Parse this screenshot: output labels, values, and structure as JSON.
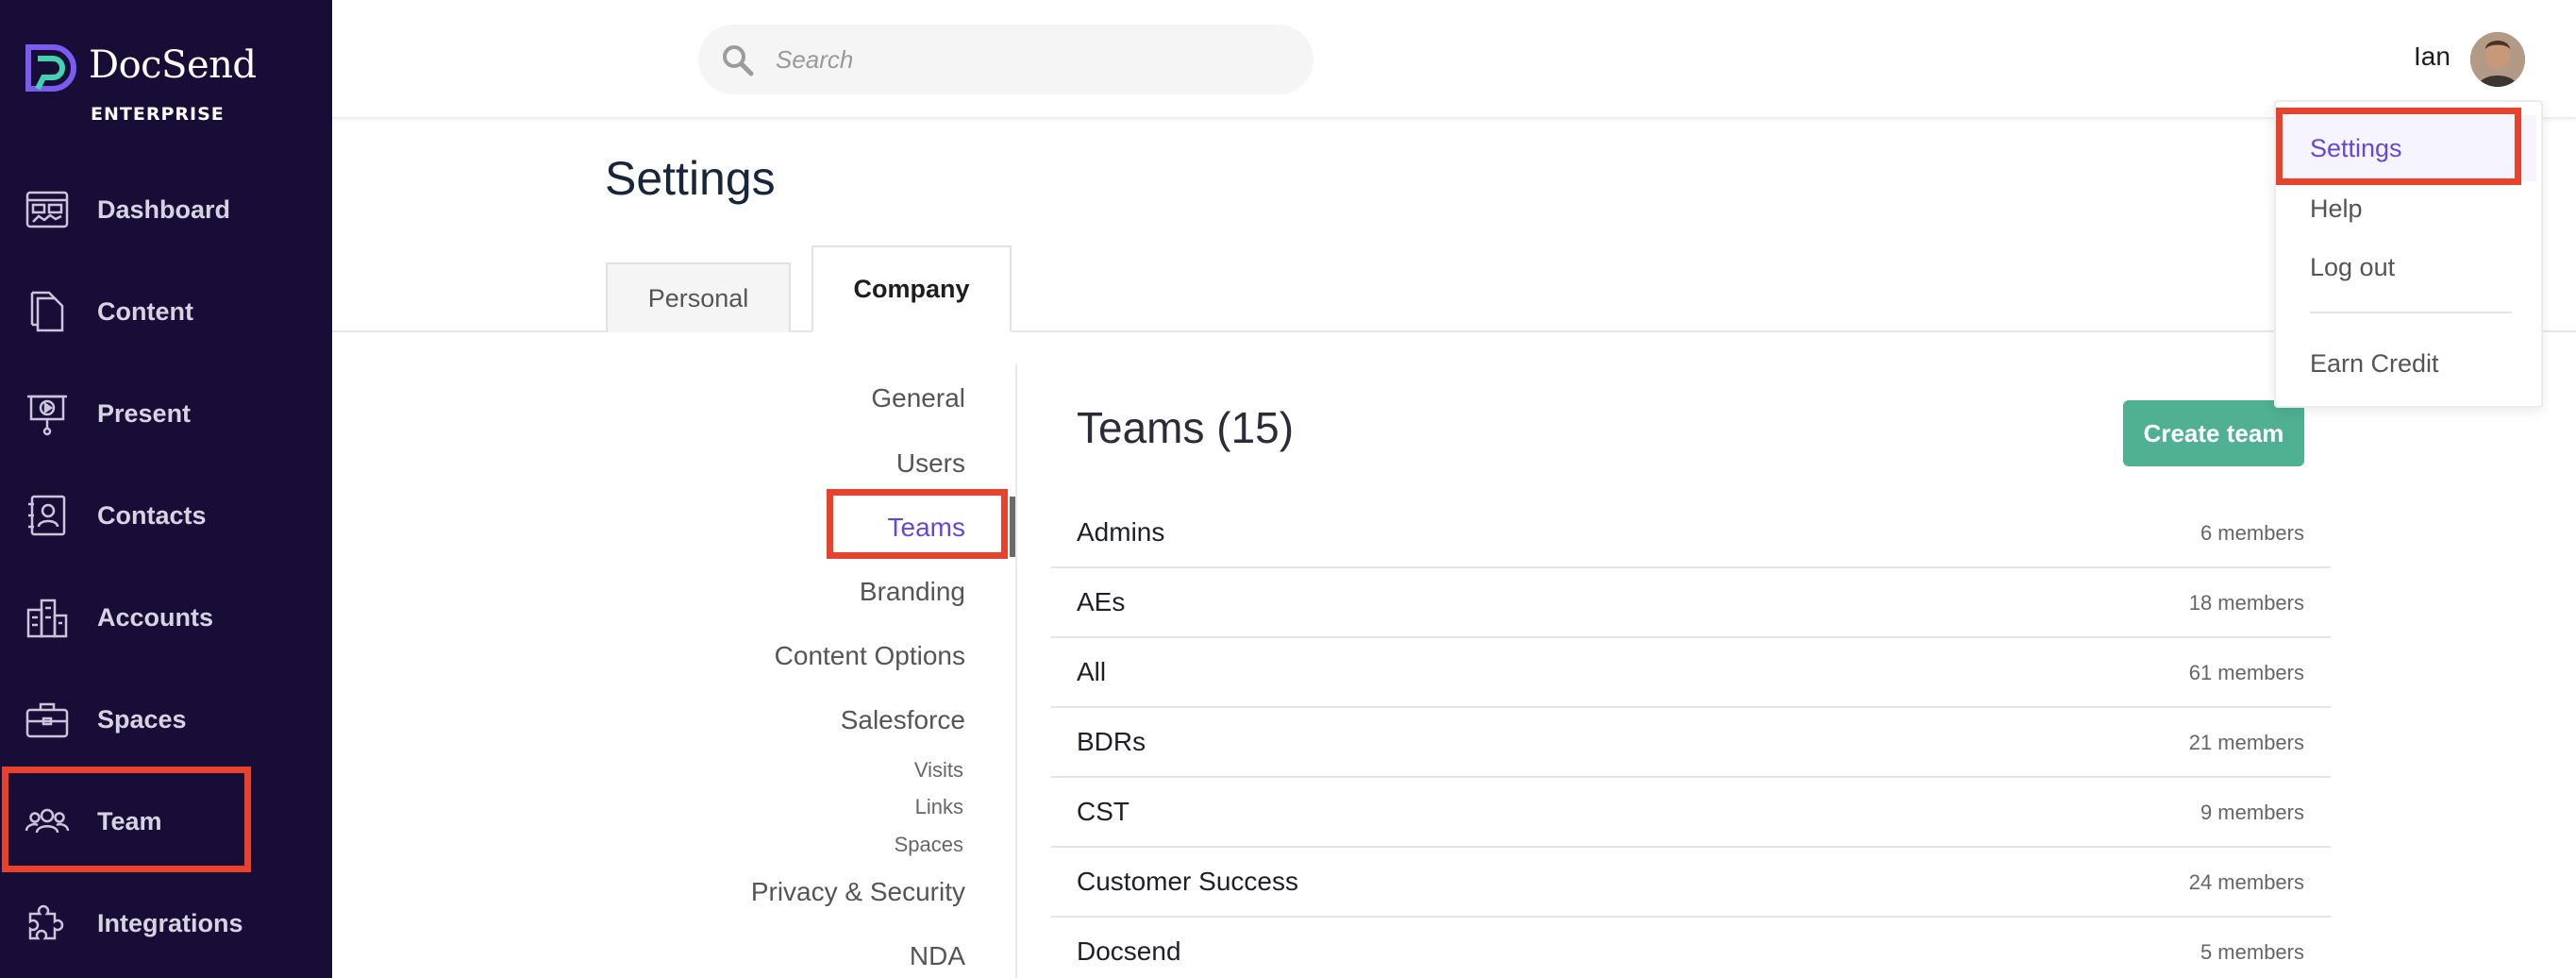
{
  "brand": {
    "name": "DocSend",
    "tier": "ENTERPRISE",
    "accent_colors": [
      "#7a5cf0",
      "#3fd3b0"
    ]
  },
  "sidebar": {
    "items": [
      {
        "label": "Dashboard",
        "icon": "dashboard-icon"
      },
      {
        "label": "Content",
        "icon": "content-icon"
      },
      {
        "label": "Present",
        "icon": "present-icon"
      },
      {
        "label": "Contacts",
        "icon": "contacts-icon"
      },
      {
        "label": "Accounts",
        "icon": "accounts-icon"
      },
      {
        "label": "Spaces",
        "icon": "spaces-icon"
      },
      {
        "label": "Team",
        "icon": "team-icon",
        "highlighted": true
      },
      {
        "label": "Integrations",
        "icon": "integrations-icon"
      }
    ]
  },
  "header": {
    "search_placeholder": "Search",
    "user_name": "Ian"
  },
  "page": {
    "title": "Settings",
    "tabs": [
      {
        "label": "Personal",
        "active": false
      },
      {
        "label": "Company",
        "active": true
      }
    ]
  },
  "settings_nav": {
    "items": [
      {
        "label": "General"
      },
      {
        "label": "Users"
      },
      {
        "label": "Teams",
        "active": true
      },
      {
        "label": "Branding"
      },
      {
        "label": "Content Options"
      },
      {
        "label": "Salesforce"
      },
      {
        "label": "Visits",
        "sub": true
      },
      {
        "label": "Links",
        "sub": true
      },
      {
        "label": "Spaces",
        "sub": true
      },
      {
        "label": "Privacy & Security"
      },
      {
        "label": "NDA"
      }
    ]
  },
  "teams": {
    "title": "Teams (15)",
    "create_button": "Create team",
    "rows": [
      {
        "name": "Admins",
        "members": "6 members"
      },
      {
        "name": "AEs",
        "members": "18 members"
      },
      {
        "name": "All",
        "members": "61 members"
      },
      {
        "name": "BDRs",
        "members": "21 members"
      },
      {
        "name": "CST",
        "members": "9 members"
      },
      {
        "name": "Customer Success",
        "members": "24 members"
      },
      {
        "name": "Docsend",
        "members": "5 members"
      }
    ]
  },
  "user_menu": {
    "items": [
      {
        "label": "Settings",
        "active": true
      },
      {
        "label": "Help"
      },
      {
        "label": "Log out"
      },
      {
        "label": "Earn Credit"
      }
    ]
  },
  "colors": {
    "sidebar_bg": "#180d36",
    "accent_purple": "#5f4bd8",
    "create_button": "#4fb092",
    "highlight_red": "#e8412c"
  }
}
